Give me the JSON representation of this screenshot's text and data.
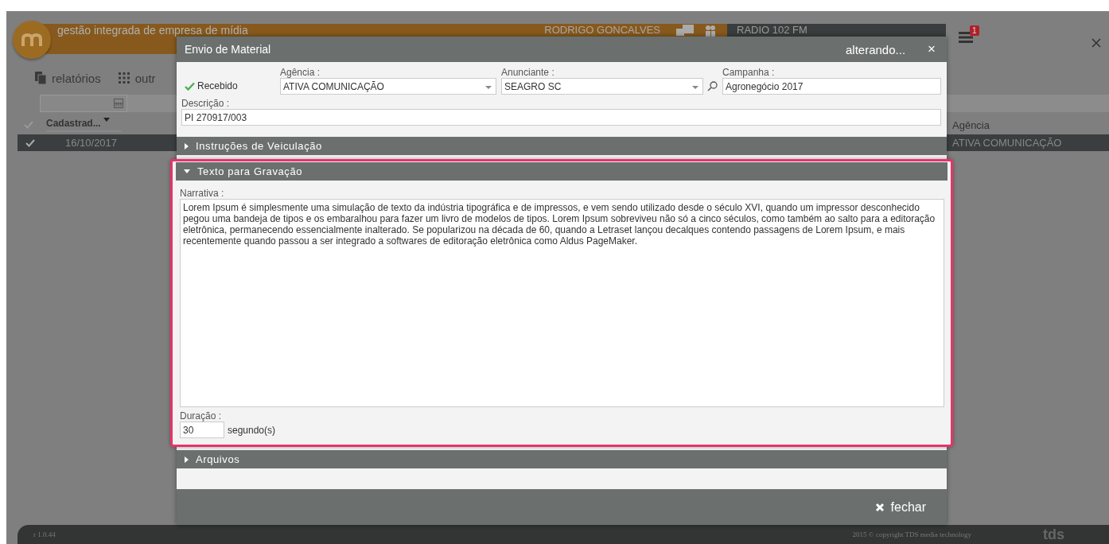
{
  "app": {
    "title": "gestão integrada de empresa de mídia",
    "user": "RODRIGO GONCALVES",
    "station": "RADIO 102 FM",
    "notification_count": "1"
  },
  "toolbar": [
    {
      "label": "relatórios",
      "kind": "report"
    },
    {
      "label": "outr",
      "kind": "grid"
    }
  ],
  "table": {
    "columns": [
      {
        "label": "Cadastrad...",
        "sorted": true
      },
      {
        "label": "Agência",
        "sorted": false
      }
    ],
    "rows": [
      {
        "selected": true,
        "cells": [
          "16/10/2017",
          "ATIVA COMUNICAÇÃO"
        ]
      }
    ]
  },
  "dialog": {
    "title": "Envio de Material",
    "status": "alterando...",
    "close": "×",
    "received": {
      "label": "Recebido",
      "checked": true
    },
    "agency": {
      "label": "Agência :",
      "value": "ATIVA COMUNICAÇÃO"
    },
    "advertiser": {
      "label": "Anunciante :",
      "value": "SEAGRO SC"
    },
    "campaign": {
      "label": "Campanha :",
      "value": "Agronegócio 2017"
    },
    "description": {
      "label": "Descrição :",
      "value": "PI 270917/003"
    },
    "sections": [
      {
        "title": "Instruções de Veiculação",
        "expanded": false,
        "highlighted": false
      },
      {
        "title": "Texto para Gravação",
        "expanded": true,
        "highlighted": true,
        "narrative_label": "Narrativa :",
        "narrative": "Lorem Ipsum é simplesmente uma simulação de texto da indústria tipográfica e de impressos, e vem sendo utilizado desde o século XVI, quando um impressor desconhecido pegou uma bandeja de tipos e os embaralhou para fazer um livro de modelos de tipos. Lorem Ipsum sobreviveu não só a cinco séculos, como também ao salto para a editoração eletrônica, permanecendo essencialmente inalterado. Se popularizou na década de 60, quando a Letraset lançou decalques contendo passagens de Lorem Ipsum, e mais recentemente quando passou a ser integrado a softwares de editoração eletrônica como Aldus PageMaker.",
        "duration_label": "Duração :",
        "duration": "30",
        "duration_unit": "segundo(s)"
      },
      {
        "title": "Arquivos",
        "expanded": false,
        "highlighted": false
      }
    ],
    "close_button": "fechar"
  },
  "footer": {
    "version": "r 1.0.44",
    "copyright": "2015 © copyright TDS media technology",
    "logo": "tds"
  }
}
